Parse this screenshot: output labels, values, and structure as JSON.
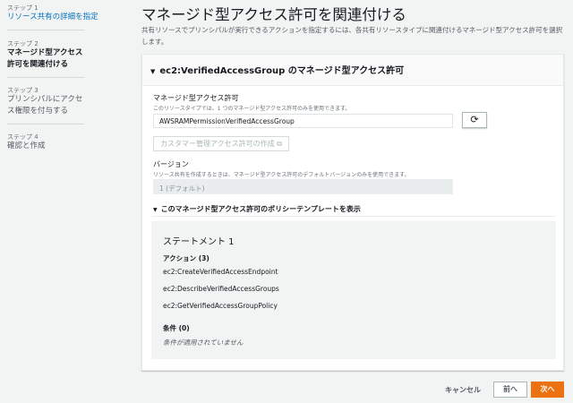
{
  "sidebar": {
    "steps": [
      {
        "label": "ステップ 1",
        "title": "リソース共有の詳細を指定"
      },
      {
        "label": "ステップ 2",
        "title": "マネージド型アクセス許可を関連付ける"
      },
      {
        "label": "ステップ 3",
        "title": "プリンシパルにアクセス権限を付与する"
      },
      {
        "label": "ステップ 4",
        "title": "確認と作成"
      }
    ]
  },
  "page": {
    "title": "マネージド型アクセス許可を関連付ける",
    "description": "共有リソースでプリンシパルが実行できるアクションを指定するには、各共有リソースタイプに関連付けるマネージド型アクセス許可を選択します。"
  },
  "card": {
    "title": "ec2:VerifiedAccessGroup のマネージド型アクセス許可",
    "permission": {
      "label": "マネージド型アクセス許可",
      "hint": "このリソースタイプでは、1 つのマネージド型アクセス許可のみを使用できます。",
      "value": "AWSRAMPermissionVerifiedAccessGroup"
    },
    "create_button": "カスタマー管理アクセス許可の作成",
    "version": {
      "label": "バージョン",
      "hint": "リソース共有を作成するときは、マネージド型アクセス許可のデフォルトバージョンのみを使用できます。",
      "value": "1 (デフォルト)"
    },
    "policy_toggle": "このマネージド型アクセス許可のポリシーテンプレートを表示",
    "policy": {
      "statement": "ステートメント 1",
      "actions_label": "アクション (3)",
      "actions": [
        "ec2:CreateVerifiedAccessEndpoint",
        "ec2:DescribeVerifiedAccessGroups",
        "ec2:GetVerifiedAccessGroupPolicy"
      ],
      "conditions_label": "条件 (0)",
      "conditions_none": "条件が適用されていません"
    }
  },
  "footer": {
    "cancel": "キャンセル",
    "prev": "前へ",
    "next": "次へ"
  },
  "colors": {
    "accent": "#0073bb",
    "primary": "#ec7211"
  }
}
